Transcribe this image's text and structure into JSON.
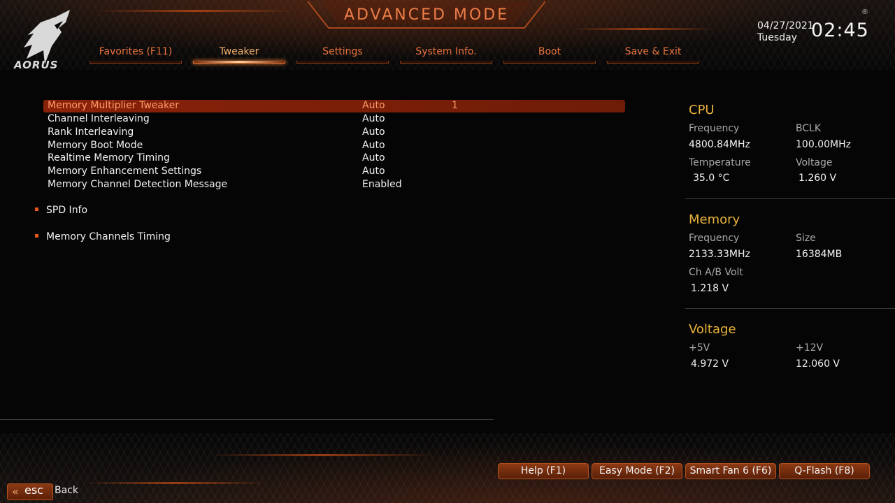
{
  "header": {
    "title": "ADVANCED MODE",
    "logo_text": "AORUS",
    "date": "04/27/2021",
    "day": "Tuesday",
    "time": "02:45",
    "reg_mark": "®"
  },
  "tabs": [
    {
      "label": "Favorites (F11)",
      "active": false
    },
    {
      "label": "Tweaker",
      "active": true
    },
    {
      "label": "Settings",
      "active": false
    },
    {
      "label": "System Info.",
      "active": false
    },
    {
      "label": "Boot",
      "active": false
    },
    {
      "label": "Save & Exit",
      "active": false
    }
  ],
  "settings": [
    {
      "label": "Memory Multiplier Tweaker",
      "value": "Auto",
      "value2": "1",
      "selected": true
    },
    {
      "label": "Channel Interleaving",
      "value": "Auto"
    },
    {
      "label": "Rank Interleaving",
      "value": "Auto"
    },
    {
      "label": "Memory Boot Mode",
      "value": "Auto"
    },
    {
      "label": "Realtime Memory Timing",
      "value": "Auto"
    },
    {
      "label": "Memory Enhancement Settings",
      "value": "Auto"
    },
    {
      "label": "Memory Channel Detection Message",
      "value": "Enabled"
    }
  ],
  "submenus": [
    {
      "label": "SPD Info"
    },
    {
      "label": "Memory Channels Timing"
    }
  ],
  "panel": {
    "cpu": {
      "title": "CPU",
      "frequency_label": "Frequency",
      "frequency": "4800.84MHz",
      "bclk_label": "BCLK",
      "bclk": "100.00MHz",
      "temperature_label": "Temperature",
      "temperature": "35.0 °C",
      "voltage_label": "Voltage",
      "voltage": "1.260 V"
    },
    "memory": {
      "title": "Memory",
      "frequency_label": "Frequency",
      "frequency": "2133.33MHz",
      "size_label": "Size",
      "size": "16384MB",
      "chab_label": "Ch A/B Volt",
      "chab": "1.218 V"
    },
    "voltage": {
      "title": "Voltage",
      "p5_label": "+5V",
      "p5": "4.972 V",
      "p12_label": "+12V",
      "p12": "12.060 V"
    }
  },
  "footer": {
    "buttons": [
      "Help (F1)",
      "Easy Mode (F2)",
      "Smart Fan 6 (F6)",
      "Q-Flash (F8)"
    ],
    "esc_label": "esc",
    "back_label": "Back"
  },
  "colors": {
    "accent": "#e8733c",
    "selection": "#8a2209",
    "panel_title": "#e8b23c"
  }
}
